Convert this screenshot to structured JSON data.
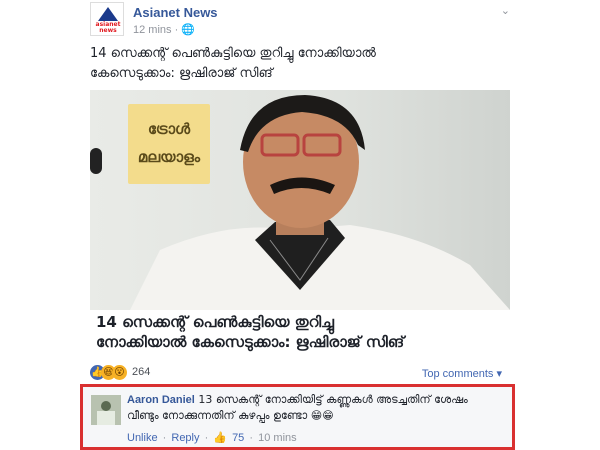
{
  "post": {
    "page_name": "Asianet News",
    "logo_text": "asianet news",
    "time": "12 mins · ",
    "audience_icon": "globe-icon",
    "status_line1": "14 സെക്കന്റ് പെൺകുട്ടിയെ തുറിച്ചു നോക്കിയാൽ",
    "status_line2": "കേസെടുക്കാം: ഋഷിരാജ് സിങ്",
    "watermark_line1": "ട്രോൾ",
    "watermark_line2": "മലയാളം",
    "caption_line1": "14 സെക്കന്റ് പെൺകുട്ടിയെ തുറിച്ചു",
    "caption_line2": "നോക്കിയാൽ കേസെടുക്കാം: ഋഷിരാജ് സിങ്"
  },
  "reactions": {
    "count": "264",
    "top_comments": "Top comments ▾"
  },
  "comment": {
    "author": "Aaron Daniel",
    "text_line1": " 13 സെകന്റ് നോക്കിയിട്ട് കണ്ണുകൾ അടച്ചതിന് ശേഷം",
    "text_line2": "വീണ്ടും നോക്കുന്നതിന് കുഴപ്പം ഉണ്ടോ 😁😁",
    "unlike": "Unlike",
    "reply": "Reply",
    "likes": "75",
    "time": "10 mins"
  }
}
